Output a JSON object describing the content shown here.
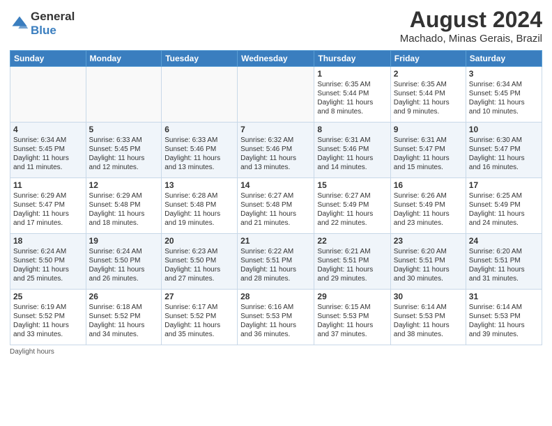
{
  "header": {
    "logo_text_general": "General",
    "logo_text_blue": "Blue",
    "month_title": "August 2024",
    "location": "Machado, Minas Gerais, Brazil"
  },
  "weekdays": [
    "Sunday",
    "Monday",
    "Tuesday",
    "Wednesday",
    "Thursday",
    "Friday",
    "Saturday"
  ],
  "footer": {
    "note": "Daylight hours"
  },
  "weeks": [
    [
      {
        "day": "",
        "info": ""
      },
      {
        "day": "",
        "info": ""
      },
      {
        "day": "",
        "info": ""
      },
      {
        "day": "",
        "info": ""
      },
      {
        "day": "1",
        "info": "Sunrise: 6:35 AM\nSunset: 5:44 PM\nDaylight: 11 hours\nand 8 minutes."
      },
      {
        "day": "2",
        "info": "Sunrise: 6:35 AM\nSunset: 5:44 PM\nDaylight: 11 hours\nand 9 minutes."
      },
      {
        "day": "3",
        "info": "Sunrise: 6:34 AM\nSunset: 5:45 PM\nDaylight: 11 hours\nand 10 minutes."
      }
    ],
    [
      {
        "day": "4",
        "info": "Sunrise: 6:34 AM\nSunset: 5:45 PM\nDaylight: 11 hours\nand 11 minutes."
      },
      {
        "day": "5",
        "info": "Sunrise: 6:33 AM\nSunset: 5:45 PM\nDaylight: 11 hours\nand 12 minutes."
      },
      {
        "day": "6",
        "info": "Sunrise: 6:33 AM\nSunset: 5:46 PM\nDaylight: 11 hours\nand 13 minutes."
      },
      {
        "day": "7",
        "info": "Sunrise: 6:32 AM\nSunset: 5:46 PM\nDaylight: 11 hours\nand 13 minutes."
      },
      {
        "day": "8",
        "info": "Sunrise: 6:31 AM\nSunset: 5:46 PM\nDaylight: 11 hours\nand 14 minutes."
      },
      {
        "day": "9",
        "info": "Sunrise: 6:31 AM\nSunset: 5:47 PM\nDaylight: 11 hours\nand 15 minutes."
      },
      {
        "day": "10",
        "info": "Sunrise: 6:30 AM\nSunset: 5:47 PM\nDaylight: 11 hours\nand 16 minutes."
      }
    ],
    [
      {
        "day": "11",
        "info": "Sunrise: 6:29 AM\nSunset: 5:47 PM\nDaylight: 11 hours\nand 17 minutes."
      },
      {
        "day": "12",
        "info": "Sunrise: 6:29 AM\nSunset: 5:48 PM\nDaylight: 11 hours\nand 18 minutes."
      },
      {
        "day": "13",
        "info": "Sunrise: 6:28 AM\nSunset: 5:48 PM\nDaylight: 11 hours\nand 19 minutes."
      },
      {
        "day": "14",
        "info": "Sunrise: 6:27 AM\nSunset: 5:48 PM\nDaylight: 11 hours\nand 21 minutes."
      },
      {
        "day": "15",
        "info": "Sunrise: 6:27 AM\nSunset: 5:49 PM\nDaylight: 11 hours\nand 22 minutes."
      },
      {
        "day": "16",
        "info": "Sunrise: 6:26 AM\nSunset: 5:49 PM\nDaylight: 11 hours\nand 23 minutes."
      },
      {
        "day": "17",
        "info": "Sunrise: 6:25 AM\nSunset: 5:49 PM\nDaylight: 11 hours\nand 24 minutes."
      }
    ],
    [
      {
        "day": "18",
        "info": "Sunrise: 6:24 AM\nSunset: 5:50 PM\nDaylight: 11 hours\nand 25 minutes."
      },
      {
        "day": "19",
        "info": "Sunrise: 6:24 AM\nSunset: 5:50 PM\nDaylight: 11 hours\nand 26 minutes."
      },
      {
        "day": "20",
        "info": "Sunrise: 6:23 AM\nSunset: 5:50 PM\nDaylight: 11 hours\nand 27 minutes."
      },
      {
        "day": "21",
        "info": "Sunrise: 6:22 AM\nSunset: 5:51 PM\nDaylight: 11 hours\nand 28 minutes."
      },
      {
        "day": "22",
        "info": "Sunrise: 6:21 AM\nSunset: 5:51 PM\nDaylight: 11 hours\nand 29 minutes."
      },
      {
        "day": "23",
        "info": "Sunrise: 6:20 AM\nSunset: 5:51 PM\nDaylight: 11 hours\nand 30 minutes."
      },
      {
        "day": "24",
        "info": "Sunrise: 6:20 AM\nSunset: 5:51 PM\nDaylight: 11 hours\nand 31 minutes."
      }
    ],
    [
      {
        "day": "25",
        "info": "Sunrise: 6:19 AM\nSunset: 5:52 PM\nDaylight: 11 hours\nand 33 minutes."
      },
      {
        "day": "26",
        "info": "Sunrise: 6:18 AM\nSunset: 5:52 PM\nDaylight: 11 hours\nand 34 minutes."
      },
      {
        "day": "27",
        "info": "Sunrise: 6:17 AM\nSunset: 5:52 PM\nDaylight: 11 hours\nand 35 minutes."
      },
      {
        "day": "28",
        "info": "Sunrise: 6:16 AM\nSunset: 5:53 PM\nDaylight: 11 hours\nand 36 minutes."
      },
      {
        "day": "29",
        "info": "Sunrise: 6:15 AM\nSunset: 5:53 PM\nDaylight: 11 hours\nand 37 minutes."
      },
      {
        "day": "30",
        "info": "Sunrise: 6:14 AM\nSunset: 5:53 PM\nDaylight: 11 hours\nand 38 minutes."
      },
      {
        "day": "31",
        "info": "Sunrise: 6:14 AM\nSunset: 5:53 PM\nDaylight: 11 hours\nand 39 minutes."
      }
    ]
  ]
}
